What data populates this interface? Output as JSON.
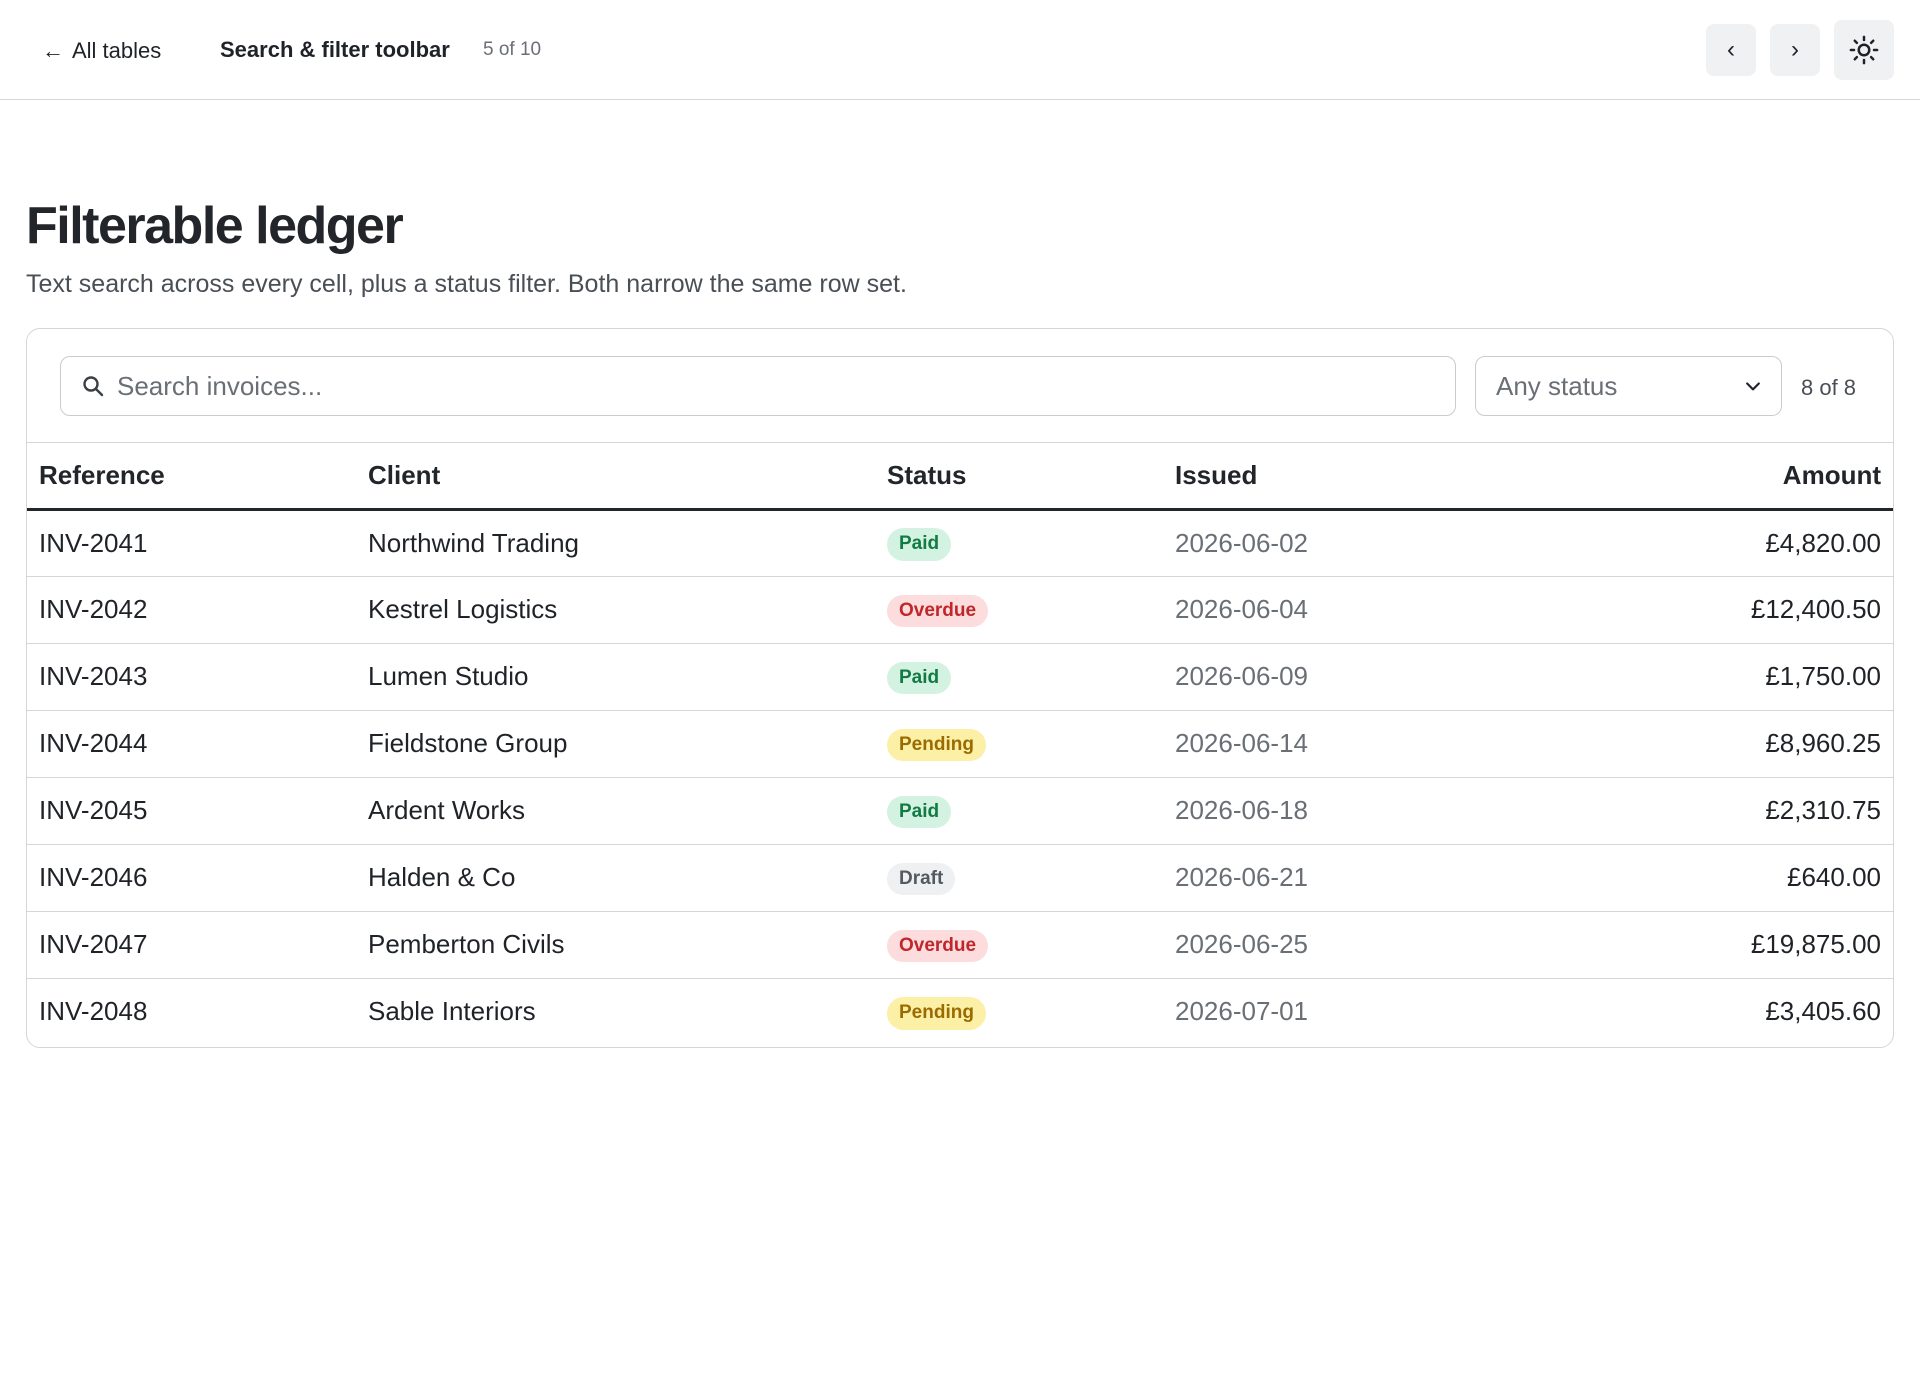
{
  "topbar": {
    "back_label": "All tables",
    "title": "Search & filter toolbar",
    "position": "5 of 10",
    "prev_icon": "chevron-left-icon",
    "next_icon": "chevron-right-icon",
    "theme_icon": "sun-icon"
  },
  "page": {
    "title": "Filterable ledger",
    "subtitle": "Text search across every cell, plus a status filter. Both narrow the same row set."
  },
  "toolbar": {
    "search_placeholder": "Search invoices...",
    "search_value": "",
    "status_selected": "Any status",
    "result_count": "8 of 8"
  },
  "table": {
    "columns": [
      "Reference",
      "Client",
      "Status",
      "Issued",
      "Amount"
    ],
    "rows": [
      {
        "reference": "INV-2041",
        "client": "Northwind Trading",
        "status": "Paid",
        "status_kind": "paid",
        "issued": "2026-06-02",
        "amount": "£4,820.00"
      },
      {
        "reference": "INV-2042",
        "client": "Kestrel Logistics",
        "status": "Overdue",
        "status_kind": "overdue",
        "issued": "2026-06-04",
        "amount": "£12,400.50"
      },
      {
        "reference": "INV-2043",
        "client": "Lumen Studio",
        "status": "Paid",
        "status_kind": "paid",
        "issued": "2026-06-09",
        "amount": "£1,750.00"
      },
      {
        "reference": "INV-2044",
        "client": "Fieldstone Group",
        "status": "Pending",
        "status_kind": "pending",
        "issued": "2026-06-14",
        "amount": "£8,960.25"
      },
      {
        "reference": "INV-2045",
        "client": "Ardent Works",
        "status": "Paid",
        "status_kind": "paid",
        "issued": "2026-06-18",
        "amount": "£2,310.75"
      },
      {
        "reference": "INV-2046",
        "client": "Halden & Co",
        "status": "Draft",
        "status_kind": "draft",
        "issued": "2026-06-21",
        "amount": "£640.00"
      },
      {
        "reference": "INV-2047",
        "client": "Pemberton Civils",
        "status": "Overdue",
        "status_kind": "overdue",
        "issued": "2026-06-25",
        "amount": "£19,875.00"
      },
      {
        "reference": "INV-2048",
        "client": "Sable Interiors",
        "status": "Pending",
        "status_kind": "pending",
        "issued": "2026-07-01",
        "amount": "£3,405.60"
      }
    ]
  },
  "colors": {
    "paid_bg": "#d3f2e1",
    "paid_fg": "#127a43",
    "overdue_bg": "#fcdcdc",
    "overdue_fg": "#c0272d",
    "pending_bg": "#fcefa6",
    "pending_fg": "#9a6b00",
    "draft_bg": "#eef0f2",
    "draft_fg": "#555a61"
  }
}
